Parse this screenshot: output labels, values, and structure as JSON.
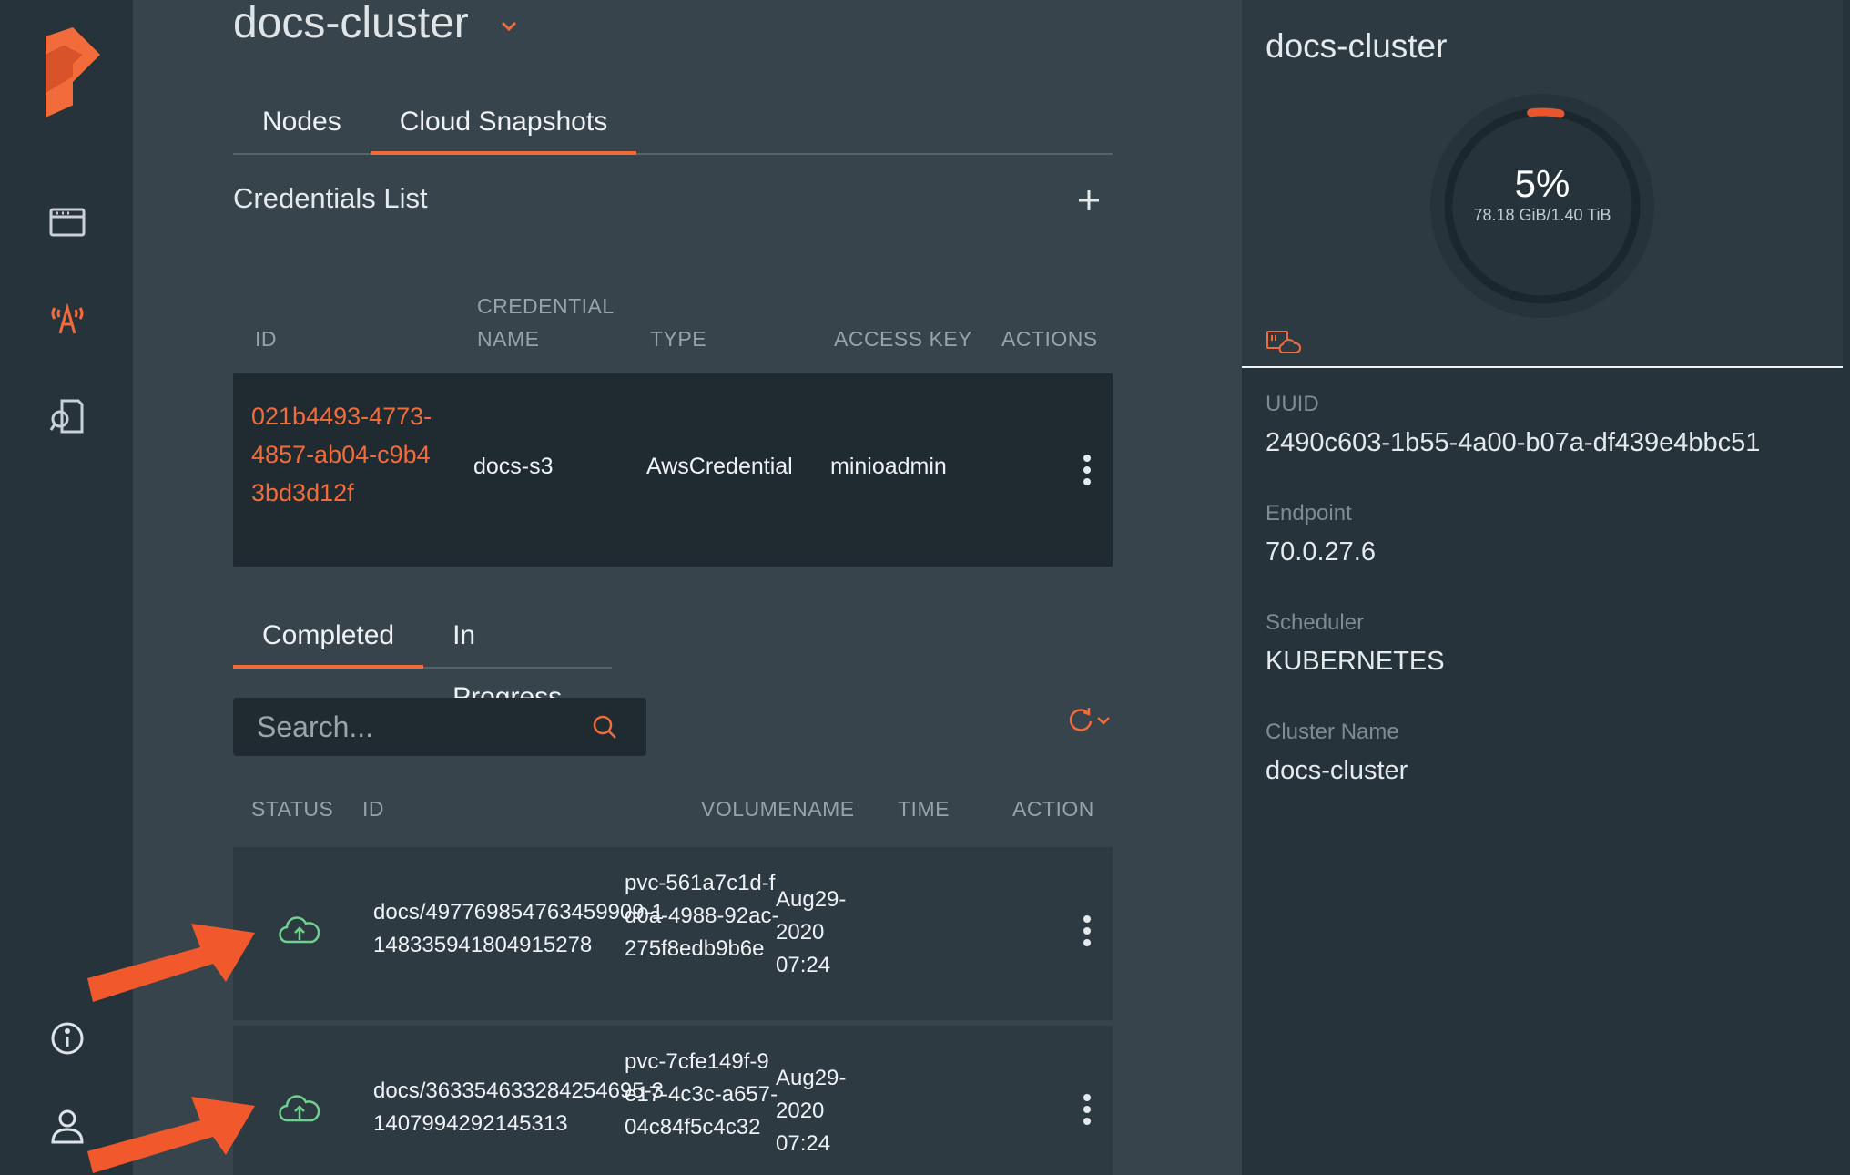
{
  "cluster": {
    "title": "docs-cluster"
  },
  "top_tabs": [
    {
      "label": "Nodes"
    },
    {
      "label": "Cloud Snapshots"
    }
  ],
  "credentials": {
    "title": "Credentials List",
    "columns": [
      "ID",
      "CREDENTIAL NAME",
      "TYPE",
      "ACCESS KEY",
      "ACTIONS"
    ],
    "column_lines": {
      "cred_name_1": "CREDENTIAL",
      "cred_name_2": "NAME"
    },
    "rows": [
      {
        "id": "021b4493-4773-4857-ab04-c9b43bd3d12f",
        "name": "docs-s3",
        "type": "AwsCredential",
        "access_key": "minioadmin"
      }
    ]
  },
  "snapshot_tabs": [
    {
      "label": "Completed"
    },
    {
      "label": "In Progress"
    }
  ],
  "search": {
    "placeholder": "Search..."
  },
  "snapshots": {
    "columns": [
      "STATUS",
      "ID",
      "VOLUMENAME",
      "TIME",
      "ACTION"
    ],
    "rows": [
      {
        "status_icon": "cloud-upload-icon",
        "id": "docs/497769854763459909-1148335941804915278",
        "volume": "pvc-561a7c1d-fd0a-4988-92ac-275f8edb9b6e",
        "time": "Aug29-2020 07:24"
      },
      {
        "status_icon": "cloud-upload-icon",
        "id": "docs/363354633284254695-31407994292145313",
        "volume": "pvc-7cfe149f-9e17-4c3c-a657-04c84f5c4c32",
        "time": "Aug29-2020 07:24"
      }
    ]
  },
  "panel": {
    "title": "docs-cluster",
    "usage_percent": 5,
    "usage_label": "5%",
    "usage_caption": "78.18 GiB/1.40 TiB",
    "fields": [
      {
        "label": "UUID",
        "value": "2490c603-1b55-4a00-b07a-df439e4bbc51"
      },
      {
        "label": "Endpoint",
        "value": "70.0.27.6"
      },
      {
        "label": "Scheduler",
        "value": "KUBERNETES"
      },
      {
        "label": "Cluster Name",
        "value": "docs-cluster"
      }
    ]
  },
  "colors": {
    "accent": "#f26b3a",
    "success": "#6fd18f",
    "rail": "#26333b",
    "main": "#37444c",
    "row_dark": "#1f2a31"
  }
}
